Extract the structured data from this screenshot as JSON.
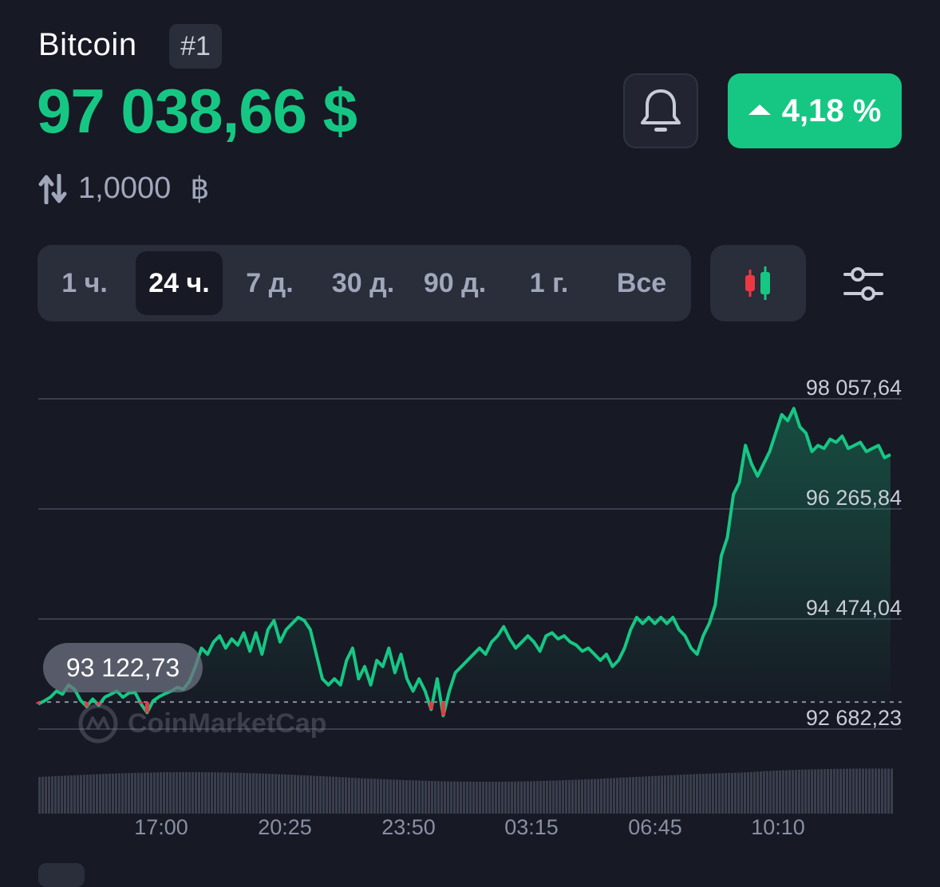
{
  "header": {
    "coin_name": "Bitcoin",
    "rank": "#1",
    "price": "97 038,66 $",
    "change": "4,18 %",
    "change_direction": "up",
    "conversion_value": "1,0000",
    "conversion_symbol": "฿"
  },
  "tabs": [
    {
      "label": "1 ч.",
      "active": false
    },
    {
      "label": "24 ч.",
      "active": true
    },
    {
      "label": "7 д.",
      "active": false
    },
    {
      "label": "30 д.",
      "active": false
    },
    {
      "label": "90 д.",
      "active": false
    },
    {
      "label": "1 г.",
      "active": false
    },
    {
      "label": "Все",
      "active": false
    }
  ],
  "icons": {
    "bell": "bell-icon",
    "change_arrow": "triangle-up-icon",
    "conversion": "swap-vertical-icon",
    "candles": "candlestick-icon",
    "settings": "sliders-icon",
    "watermark": "coinmarketcap-logo"
  },
  "colors": {
    "background": "#171924",
    "up": "#16c784",
    "down": "#ea3943",
    "surface": "#2a2d3a",
    "muted": "#a1a7bb"
  },
  "tooltip": "93 122,73",
  "watermark": "CoinMarketCap",
  "chart_data": {
    "type": "area",
    "y_ticks": [
      "98 057,64",
      "96 265,84",
      "94 474,04",
      "92 682,23"
    ],
    "x_ticks": [
      "17:00",
      "20:25",
      "23:50",
      "03:15",
      "06:45",
      "10:10"
    ],
    "baseline": 93122.73,
    "ylim": [
      92682.23,
      98057.64
    ],
    "grid": true,
    "series": [
      {
        "values": [
          93090,
          93140,
          93200,
          93300,
          93250,
          93400,
          93330,
          93150,
          93050,
          93170,
          93070,
          93200,
          93250,
          93300,
          93200,
          93270,
          93280,
          93090,
          92950,
          93140,
          93210,
          93260,
          93300,
          93360,
          93330,
          93460,
          93700,
          94000,
          93900,
          94100,
          94200,
          94000,
          94150,
          94050,
          94250,
          93950,
          94250,
          93900,
          94300,
          94450,
          94100,
          94300,
          94400,
          94500,
          94450,
          94300,
          93900,
          93500,
          93400,
          93500,
          93400,
          93800,
          94000,
          93500,
          93700,
          93400,
          93800,
          93700,
          94000,
          93600,
          93900,
          93500,
          93300,
          93500,
          93300,
          93000,
          93500,
          92900,
          93300,
          93600,
          93700,
          93800,
          93900,
          94000,
          93900,
          94100,
          94200,
          94350,
          94150,
          94000,
          94100,
          94200,
          94100,
          93950,
          94200,
          94250,
          94150,
          94200,
          94100,
          94050,
          93950,
          94000,
          93900,
          93800,
          93900,
          93700,
          93800,
          94000,
          94300,
          94500,
          94400,
          94500,
          94400,
          94500,
          94400,
          94500,
          94300,
          94200,
          94000,
          93900,
          94200,
          94400,
          94700,
          95500,
          95800,
          96500,
          96700,
          97300,
          97000,
          96800,
          97000,
          97200,
          97500,
          97800,
          97700,
          97900,
          97600,
          97500,
          97200,
          97300,
          97250,
          97400,
          97350,
          97450,
          97250,
          97300,
          97350,
          97200,
          97250,
          97300,
          97100,
          97150
        ]
      }
    ]
  }
}
